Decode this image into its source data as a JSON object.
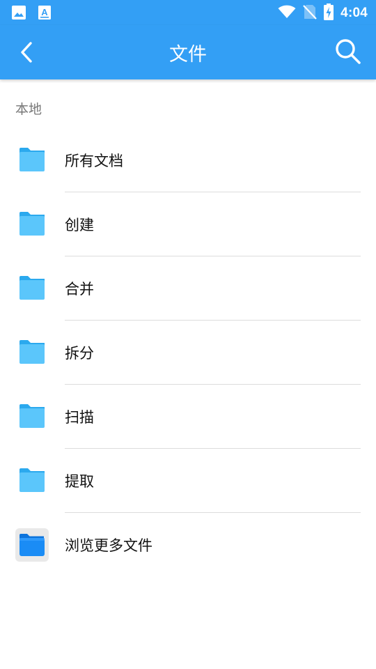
{
  "status_bar": {
    "time": "4:04",
    "icons": [
      "image-icon",
      "text-a-icon",
      "wifi-icon",
      "no-sim-icon",
      "battery-charging-icon"
    ]
  },
  "toolbar": {
    "title": "文件",
    "back_icon": "back-arrow-icon",
    "search_icon": "search-icon"
  },
  "section": {
    "label": "本地"
  },
  "items": [
    {
      "label": "所有文档",
      "icon": "folder-icon"
    },
    {
      "label": "创建",
      "icon": "folder-icon"
    },
    {
      "label": "合并",
      "icon": "folder-icon"
    },
    {
      "label": "拆分",
      "icon": "folder-icon"
    },
    {
      "label": "扫描",
      "icon": "folder-icon"
    },
    {
      "label": "提取",
      "icon": "folder-icon"
    },
    {
      "label": "浏览更多文件",
      "icon": "files-app-icon"
    }
  ],
  "colors": {
    "primary": "#339ff5",
    "folder": "#5bc6fb",
    "folder_tab": "#2ba9ee",
    "files_app": "#1a8cf5"
  }
}
